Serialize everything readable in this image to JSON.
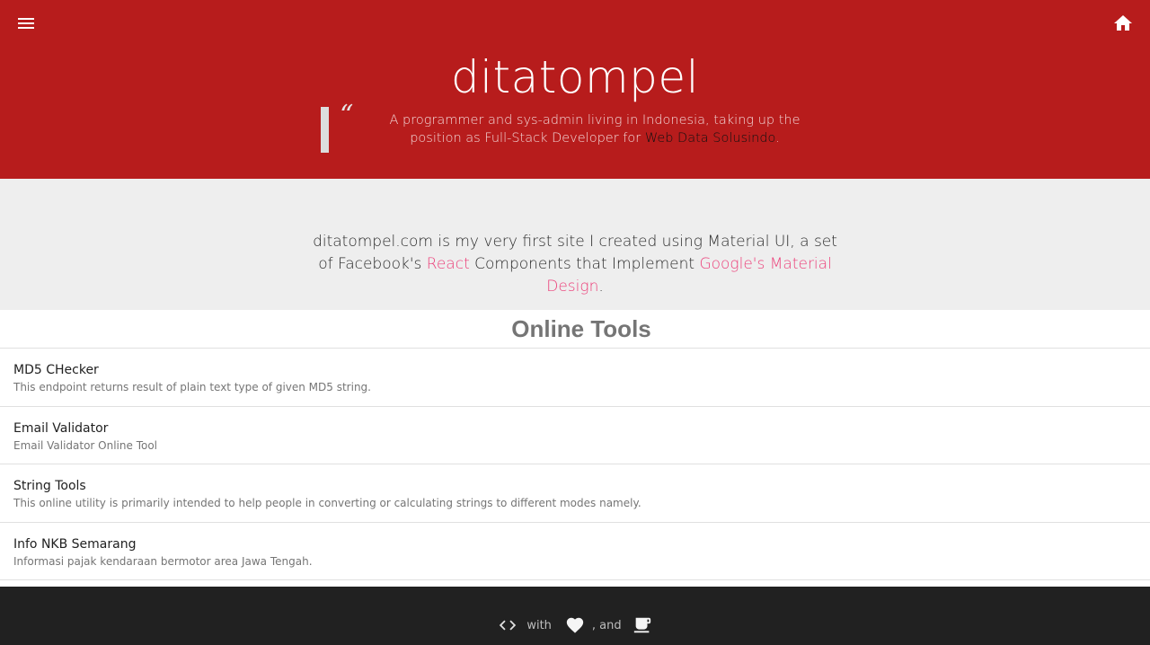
{
  "header": {
    "menu_icon": "menu-icon",
    "home_icon": "home-icon",
    "title": "ditatompel",
    "quote_mark": "“",
    "tagline_text": "A programmer and sys-admin living in Indonesia, taking up the position as Full-Stack Developer for ",
    "tagline_link": "Web Data Solusindo",
    "tagline_end": "."
  },
  "intro": {
    "part1": "ditatompel.com is my very first site I created using Material UI, a set of Facebook's ",
    "react_link": "React",
    "part2": " Components that Implement ",
    "material_link": "Google's Material Design",
    "part3": "."
  },
  "tools": {
    "heading": "Online Tools",
    "items": [
      {
        "name": "MD5 CHecker",
        "description": "This endpoint returns result of plain text type of given MD5 string."
      },
      {
        "name": "Email Validator",
        "description": "Email Validator Online Tool"
      },
      {
        "name": "String Tools",
        "description": "This online utility is primarily intended to help people in converting or calculating strings to different modes namely."
      },
      {
        "name": "Info NKB Semarang",
        "description": "Informasi pajak kendaraan bermotor area Jawa Tengah."
      }
    ]
  },
  "footer": {
    "code_icon": "code-icon",
    "with_text": "with",
    "heart_icon": "heart-icon",
    "and_text": ", and",
    "coffee_icon": "coffee-icon"
  },
  "colors": {
    "header_bg": "#b71c1c",
    "intro_bg": "#eeeeee",
    "link_accent": "#ec407a",
    "footer_bg": "#212121"
  }
}
